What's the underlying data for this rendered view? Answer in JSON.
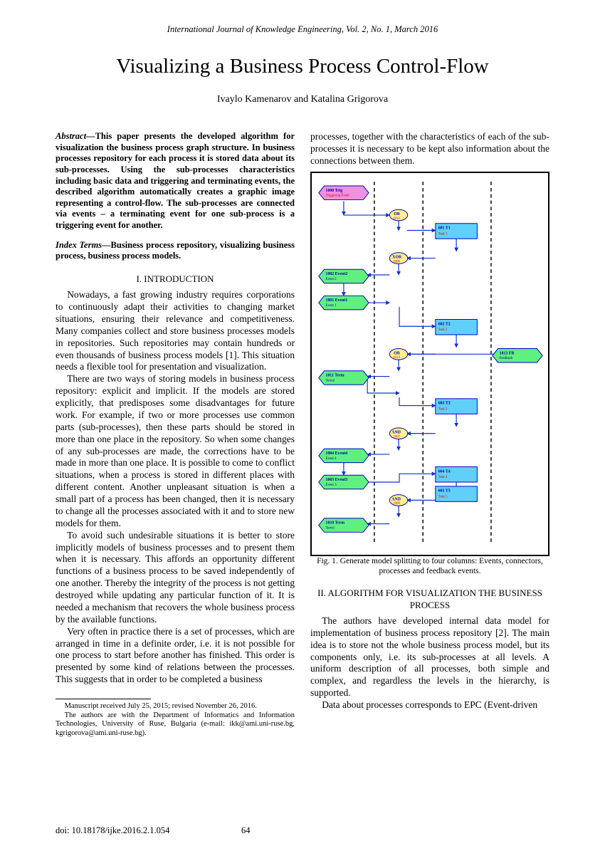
{
  "running_head": "International Journal of Knowledge Engineering, Vol. 2, No. 1, March 2016",
  "title": "Visualizing a Business Process Control-Flow",
  "authors": "Ivaylo Kamenarov and Katalina Grigorova",
  "abstract_label": "Abstract—",
  "abstract": "This paper presents the developed algorithm for visualization the business process graph structure. In business processes repository for each process it is stored data about its sub-processes. Using the sub-processes characteristics including basic data and triggering and terminating events, the described algorithm automatically creates a graphic image representing a control-flow. The sub-processes are connected via events – a terminating event for one sub-process is a triggering event for another.",
  "index_terms_label": "Index Terms—",
  "index_terms": "Business process repository, visualizing business process, business process models.",
  "section1_heading": "I.    INTRODUCTION",
  "intro_p1": "Nowadays, a fast growing industry requires corporations to continuously adapt their activities to changing market situations, ensuring their relevance and competitiveness. Many companies collect and store business processes models in repositories. Such repositories may contain hundreds or even thousands of business process models [1]. This situation needs a flexible tool for presentation and visualization.",
  "intro_p2": "There are two ways of storing models in business process repository: explicit and implicit. If the models are stored explicitly, that predisposes some disadvantages for future work. For example, if two or more processes use common parts (sub-processes), then these parts should be stored in more than one place in the repository. So when some changes of any sub-processes are made, the corrections have to be made in more than one place. It is possible to come to conflict situations, when a process is stored in different places with different content. Another unpleasant situation is when a small part of a process has been changed, then it is necessary to change all the processes associated with it and to store new models for them.",
  "intro_p3": "To avoid such undesirable situations it is better to store implicitly models of business processes and to present them when it is necessary. This affords an opportunity different functions of a business process to be saved independently of one another. Thereby the integrity of the process is not getting destroyed while updating any particular function of it. It is needed a mechanism that recovers the whole business process by the available functions.",
  "intro_p4": "Very often in practice there is a set of processes, which are arranged in time in a definite order, i.e. it is not possible for one process to start before another has finished. This order is presented by some kind of relations between the processes. This suggests that in order to be completed a business",
  "col2_p1": "processes, together with the characteristics of each of the sub-processes it is necessary to be kept also information about the connections between them.",
  "fn1": "Manuscript received July 25, 2015; revised November 26, 2016.",
  "fn2": "The authors are with the Department of Informatics and Information Technologies, University of Ruse, Bulgaria (e-mail: ikk@ami.uni-ruse.bg, kgrigorova@ami.uni-ruse.bg).",
  "section2_heading": "II.    ALGORITHM FOR VISUALIZATION THE BUSINESS PROCESS",
  "sec2_p1": "The authors have developed internal data model for implementation of business process repository [2]. The main idea is to store not the whole business process model, but its components only, i.e. its sub-processes at all levels. A uniform description of all processes, both simple and complex, and regardless the levels in the hierarchy, is supported.",
  "sec2_p2": "Data about processes corresponds to EPC (Event-driven",
  "fig_caption": "Fig. 1. Generate model splitting to four columns: Events, connectors, processes and feedback events.",
  "doi": "doi: 10.18178/ijke.2016.2.1.054",
  "page_no": "64",
  "figure_nodes": {
    "trig": {
      "id": "1000 Trig",
      "label": "Triggering Event"
    },
    "or1": {
      "id": "OR",
      "sub": "1012"
    },
    "t1": {
      "id": "601 T1",
      "label": "Task 1"
    },
    "xor": {
      "id": "XOR",
      "sub": "1006"
    },
    "ev2": {
      "id": "1002 Event2",
      "label": "Event 2"
    },
    "ev1": {
      "id": "1001 Event1",
      "label": "Event 1"
    },
    "t2": {
      "id": "602 T2",
      "label": "Task 2"
    },
    "or2": {
      "id": "OR",
      "sub": "1014"
    },
    "fb": {
      "id": "1013 FB",
      "label": "Feedback"
    },
    "term2": {
      "id": "1011 Term",
      "label": "Term2"
    },
    "t3": {
      "id": "603 T3",
      "label": "Task 3"
    },
    "and1": {
      "id": "AND",
      "sub": "1007"
    },
    "ev4": {
      "id": "1004 Event4",
      "label": "Event 4"
    },
    "ev3": {
      "id": "1003 Event3",
      "label": "Event 3"
    },
    "t4": {
      "id": "604 T4",
      "label": "Task 4"
    },
    "t5": {
      "id": "605 T5",
      "label": "Task 5"
    },
    "and2": {
      "id": "AND",
      "sub": "1009"
    },
    "term1": {
      "id": "1010 Term",
      "label": "Term1"
    }
  }
}
